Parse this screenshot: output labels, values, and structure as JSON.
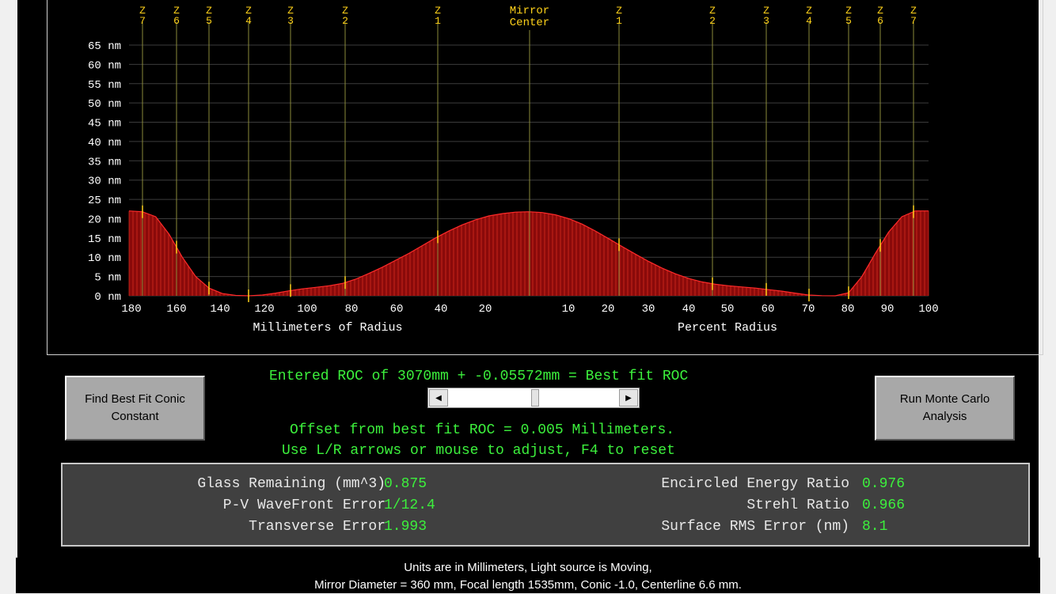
{
  "chart_data": {
    "type": "area",
    "ylabels": [
      "65 nm",
      "60 nm",
      "55 nm",
      "50 nm",
      "45 nm",
      "40 nm",
      "35 nm",
      "30 nm",
      "25 nm",
      "20 nm",
      "15 nm",
      "10 nm",
      "5 nm",
      "0 nm"
    ],
    "yvalues": [
      65,
      60,
      55,
      50,
      45,
      40,
      35,
      30,
      25,
      20,
      15,
      10,
      5,
      0
    ],
    "ylim": [
      0,
      65
    ],
    "mm_ticks": [
      "180",
      "160",
      "140",
      "120",
      "100",
      "80",
      "60",
      "40",
      "20"
    ],
    "pct_ticks": [
      "10",
      "20",
      "30",
      "40",
      "50",
      "60",
      "70",
      "80",
      "90",
      "100"
    ],
    "xlabel_left": "Millimeters of Radius",
    "xlabel_right": "Percent Radius",
    "zones_left": [
      "7",
      "6",
      "5",
      "4",
      "3",
      "2",
      "1"
    ],
    "zones_right": [
      "1",
      "2",
      "3",
      "4",
      "5",
      "6",
      "7"
    ],
    "zone_prefix": "Z",
    "center_label": [
      "Mirror",
      "Center"
    ],
    "profile": [
      22,
      21.8,
      20.5,
      16,
      10,
      5,
      2,
      0.6,
      0.1,
      0,
      0.2,
      0.7,
      1.3,
      1.8,
      2.2,
      2.6,
      3.2,
      4.3,
      5.8,
      7.4,
      9.2,
      11,
      13,
      15,
      16.8,
      18.4,
      19.7,
      20.7,
      21.3,
      21.7,
      21.8,
      21.6,
      21,
      20,
      18.6,
      16.8,
      14.8,
      12.8,
      10.8,
      8.9,
      7.2,
      5.7,
      4.5,
      3.6,
      3,
      2.6,
      2.3,
      2,
      1.6,
      1.2,
      0.7,
      0.2,
      0.05,
      0,
      0.8,
      5,
      11,
      16.5,
      20.5,
      22,
      22
    ],
    "grid": true
  },
  "colors": {
    "fill": "#8a0a0a",
    "hatch": "#e03020",
    "curve": "#ff2a2a",
    "zone": "#8a8a3a",
    "grid": "#3c3c3c",
    "marker": "#ffd21a"
  },
  "roc_text": "Entered ROC of 3070mm + -0.05572mm = Best fit ROC",
  "offset_text": "Offset from best fit ROC = 0.005 Millimeters.",
  "adjust_text": "Use L/R arrows or mouse to adjust, F4 to reset",
  "buttons": {
    "conic": [
      "Find Best Fit Conic",
      "Constant"
    ],
    "monte": [
      "Run Monte Carlo",
      "Analysis"
    ]
  },
  "scroll": {
    "left": "◀",
    "right": "▶"
  },
  "stats": {
    "glass_label": "Glass Remaining (mm^3)",
    "glass_value": "0.875",
    "pv_label": "P-V WaveFront Error",
    "pv_value": "1/12.4",
    "transverse_label": "Transverse Error",
    "transverse_value": "1.993",
    "encircled_label": "Encircled Energy Ratio",
    "encircled_value": "0.976",
    "strehl_label": "Strehl Ratio",
    "strehl_value": "0.966",
    "rms_label": "Surface RMS Error (nm)",
    "rms_value": "8.1"
  },
  "footer": {
    "line1": "Units are in Millimeters, Light source is Moving,",
    "line2": "Mirror Diameter = 360 mm, Focal length 1535mm, Conic -1.0, Centerline 6.6 mm."
  }
}
